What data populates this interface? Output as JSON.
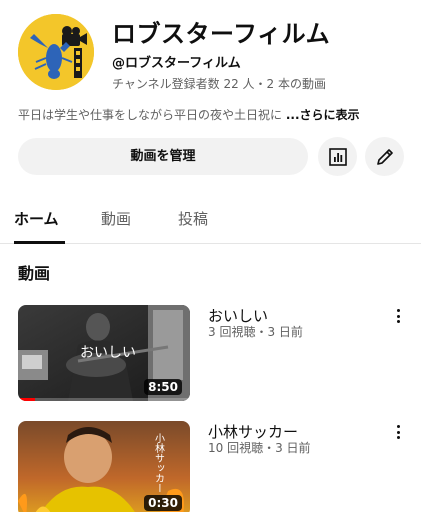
{
  "channel": {
    "name": "ロブスターフィルム",
    "handle": "@ロブスターフィルム",
    "meta": "チャンネル登録者数 22 人・2 本の動画",
    "description": "平日は学生や仕事をしながら平日の夜や土日祝に",
    "more_label": "...さらに表示",
    "avatar_icon": "lobster-film-logo",
    "avatar_color": "#f3c62a"
  },
  "actions": {
    "manage_label": "動画を管理",
    "analytics_icon": "analytics-icon",
    "edit_icon": "pencil-icon"
  },
  "tabs": [
    {
      "label": "ホーム",
      "active": true
    },
    {
      "label": "動画",
      "active": false
    },
    {
      "label": "投稿",
      "active": false
    }
  ],
  "section": {
    "title": "動画"
  },
  "videos": [
    {
      "title": "おいしい",
      "meta": "3 回視聴・3 日前",
      "duration": "8:50",
      "thumb_text": "おいしい",
      "progress": 0.1
    },
    {
      "title": "小林サッカー",
      "meta": "10 回視聴・3 日前",
      "duration": "0:30",
      "thumb_text": "小林サッカー"
    }
  ],
  "colors": {
    "accent": "#ff0000",
    "text": "#0f0f0f",
    "secondary": "#606060",
    "button_bg": "#f2f2f2"
  }
}
